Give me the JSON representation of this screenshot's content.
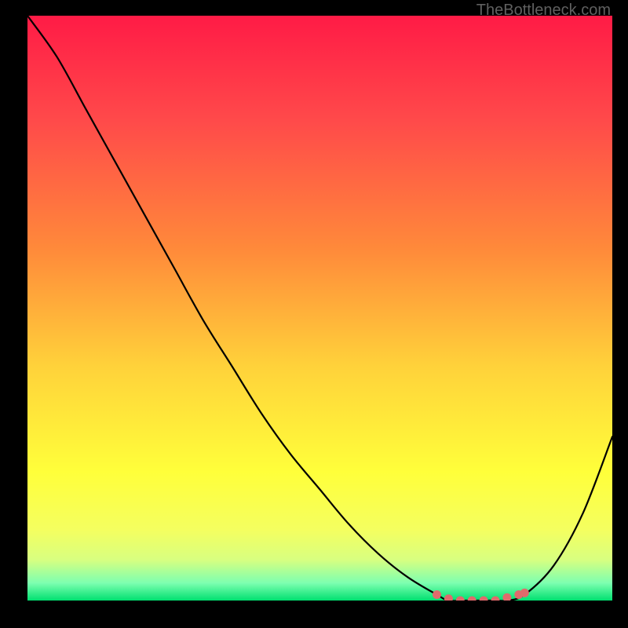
{
  "attribution": "TheBottleneck.com",
  "chart_data": {
    "type": "line",
    "title": "",
    "xlabel": "",
    "ylabel": "",
    "xlim": [
      0,
      100
    ],
    "ylim": [
      0,
      100
    ],
    "grid": false,
    "legend": false,
    "series": [
      {
        "name": "bottleneck-curve",
        "x": [
          0,
          5,
          10,
          15,
          20,
          25,
          30,
          35,
          40,
          45,
          50,
          55,
          60,
          65,
          70,
          72,
          75,
          78,
          80,
          82,
          85,
          90,
          95,
          100
        ],
        "y": [
          100,
          93,
          84,
          75,
          66,
          57,
          48,
          40,
          32,
          25,
          19,
          13,
          8,
          4,
          1,
          0,
          0,
          0,
          0,
          0,
          1,
          6,
          15,
          28
        ]
      },
      {
        "name": "optimal-region-markers",
        "x": [
          70,
          72,
          74,
          76,
          78,
          80,
          82,
          84,
          85
        ],
        "y": [
          1,
          0.3,
          0,
          0,
          0,
          0,
          0.5,
          1,
          1.3
        ]
      }
    ],
    "background_gradient_stops": [
      {
        "offset": 0.0,
        "color": "#ff1b46"
      },
      {
        "offset": 0.18,
        "color": "#ff4a4a"
      },
      {
        "offset": 0.4,
        "color": "#ff8a3a"
      },
      {
        "offset": 0.6,
        "color": "#ffd23a"
      },
      {
        "offset": 0.78,
        "color": "#ffff3a"
      },
      {
        "offset": 0.88,
        "color": "#f4ff60"
      },
      {
        "offset": 0.93,
        "color": "#d8ff80"
      },
      {
        "offset": 0.97,
        "color": "#7dffb0"
      },
      {
        "offset": 1.0,
        "color": "#00e070"
      }
    ],
    "marker_color": "#e06a6c"
  }
}
